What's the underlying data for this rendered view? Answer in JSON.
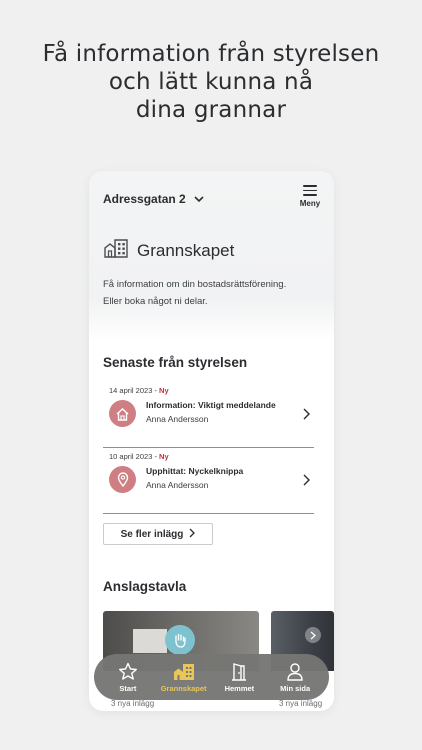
{
  "headline": {
    "line1": "Få information från styrelsen",
    "line2": "och lätt kunna nå",
    "line3": "dina grannar"
  },
  "app": {
    "address": "Adressgatan 2",
    "menu_label": "Meny",
    "section_title": "Grannskapet",
    "intro_line1": "Få information om din bostadsrättsförening.",
    "intro_line2": "Eller boka något ni delar."
  },
  "news": {
    "heading": "Senaste från styrelsen",
    "items": [
      {
        "date": "14 april 2023",
        "badge": "Ny",
        "title": "Information: Viktigt meddelande",
        "author": "Anna Andersson",
        "icon": "house-icon"
      },
      {
        "date": "10 april 2023",
        "badge": "Ny",
        "title": "Upphittat: Nyckelknippa",
        "author": "Anna Andersson",
        "icon": "location-pin-icon"
      }
    ],
    "more_label": "Se fler inlägg"
  },
  "board": {
    "heading": "Anslagstavla",
    "cards": [
      {
        "count": "3 nya inlägg",
        "icon": "wave-hand-icon"
      },
      {
        "count": "3 nya inlägg",
        "icon": "chevron-right-icon"
      }
    ]
  },
  "tabbar": {
    "items": [
      {
        "label": "Start",
        "icon": "star-icon",
        "active": false
      },
      {
        "label": "Grannskapet",
        "icon": "buildings-icon",
        "active": true
      },
      {
        "label": "Hemmet",
        "icon": "door-icon",
        "active": false
      },
      {
        "label": "Min sida",
        "icon": "person-icon",
        "active": false
      }
    ]
  },
  "colors": {
    "background": "#eff0ef",
    "accent_badge": "#c0303d",
    "icon_circle": "#cf7f83",
    "tab_active": "#e9c65a",
    "tabbar_bg": "#767674"
  }
}
